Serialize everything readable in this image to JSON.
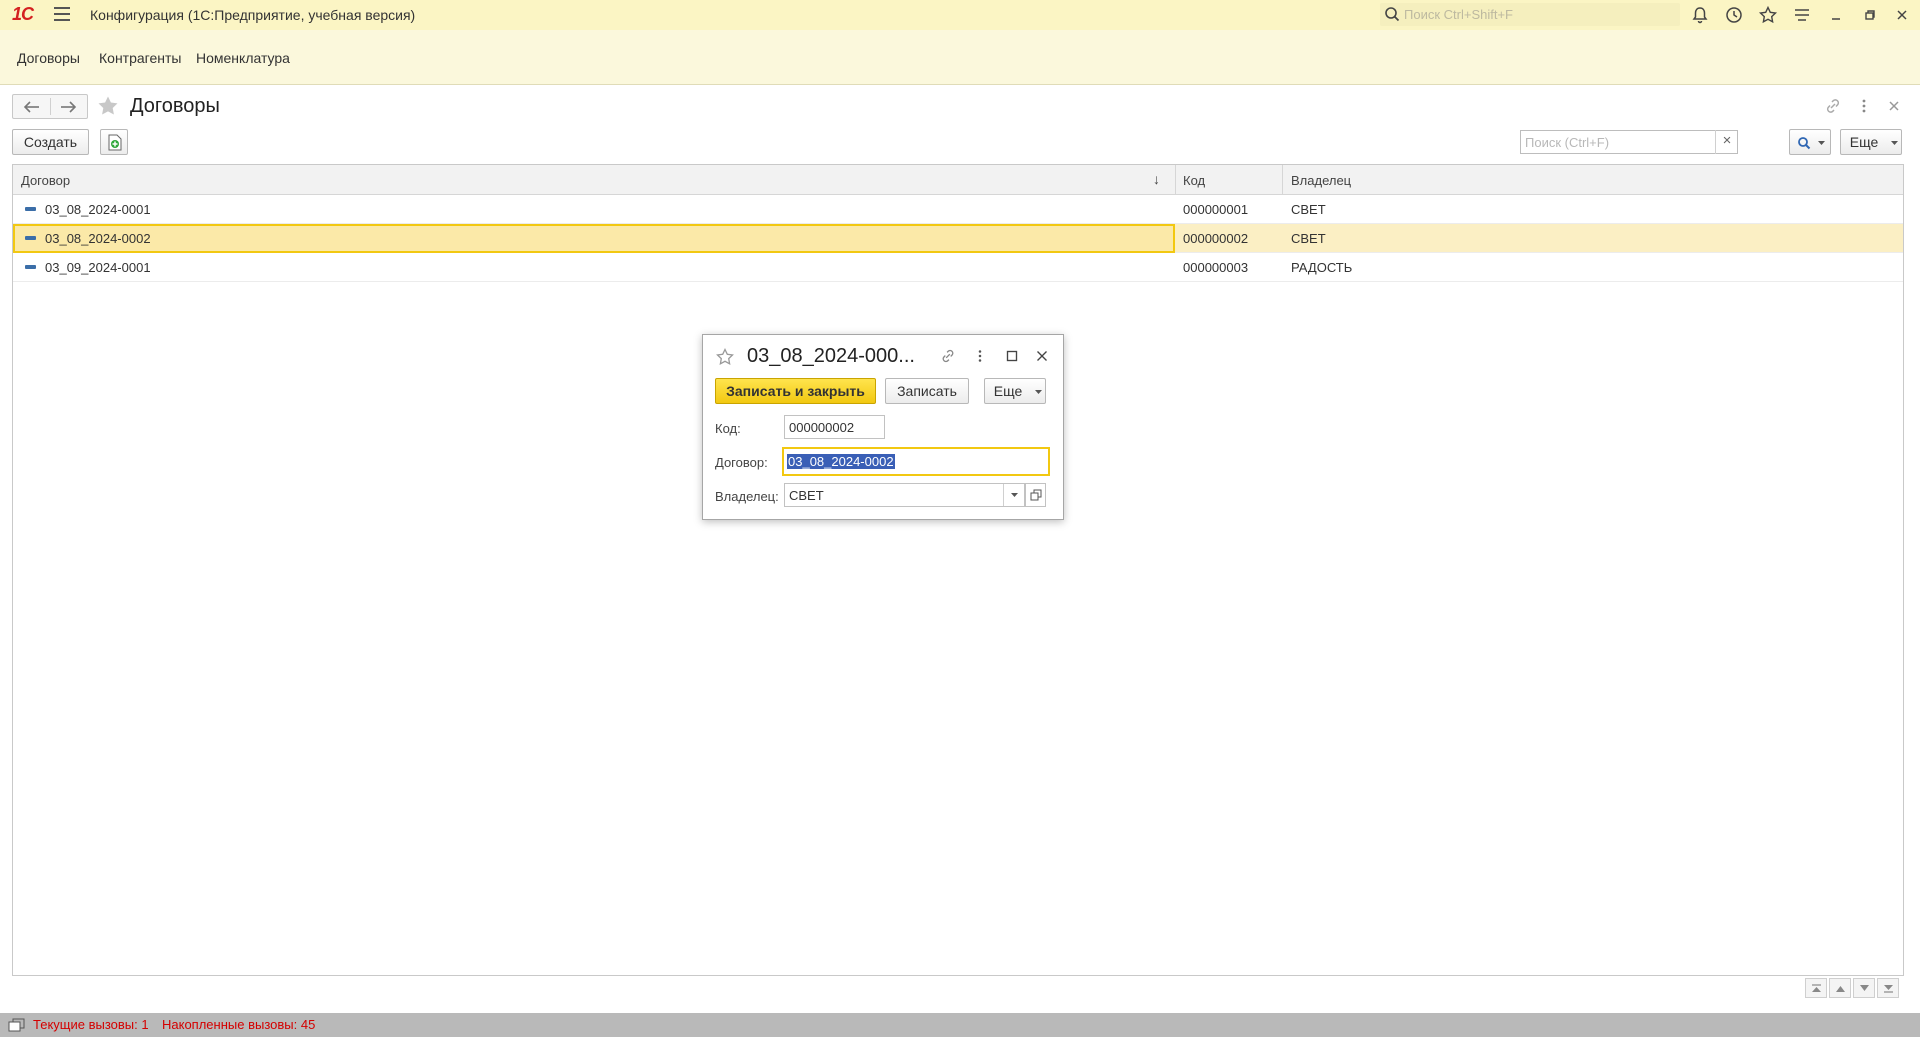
{
  "titlebar": {
    "logo": "1С",
    "title": "Конфигурация  (1С:Предприятие, учебная версия)",
    "search_placeholder": "Поиск Ctrl+Shift+F"
  },
  "sections": {
    "items": [
      {
        "label": "Договоры"
      },
      {
        "label": "Контрагенты"
      },
      {
        "label": "Номенклатура"
      }
    ]
  },
  "form": {
    "title": "Договоры",
    "create_label": "Создать",
    "search_placeholder": "Поиск (Ctrl+F)",
    "clear_symbol": "×",
    "more_label": "Еще"
  },
  "table": {
    "columns": [
      "Договор",
      "Код",
      "Владелец"
    ],
    "sort_indicator": "↓",
    "rows": [
      {
        "contract": "03_08_2024-0001",
        "code": "000000001",
        "owner": "СВЕТ"
      },
      {
        "contract": "03_08_2024-0002",
        "code": "000000002",
        "owner": "СВЕТ"
      },
      {
        "contract": "03_09_2024-0001",
        "code": "000000003",
        "owner": "РАДОСТЬ"
      }
    ],
    "selected_row": 1
  },
  "dialog": {
    "title": "03_08_2024-000...",
    "save_close_label": "Записать и закрыть",
    "save_label": "Записать",
    "more_label": "Еще",
    "code_label": "Код:",
    "code_value": "000000002",
    "contract_label": "Договор:",
    "contract_value": "03_08_2024-0002",
    "owner_label": "Владелец:",
    "owner_value": "СВЕТ"
  },
  "statusbar": {
    "current_calls": "Текущие вызовы: 1",
    "accumulated_calls": "Накопленные вызовы: 45"
  },
  "colors": {
    "titlebar_bg": "#fbf5c4",
    "accent_yellow": "#f2c811",
    "selected_row_bg": "#fbefc4",
    "status_red": "#d40000"
  }
}
